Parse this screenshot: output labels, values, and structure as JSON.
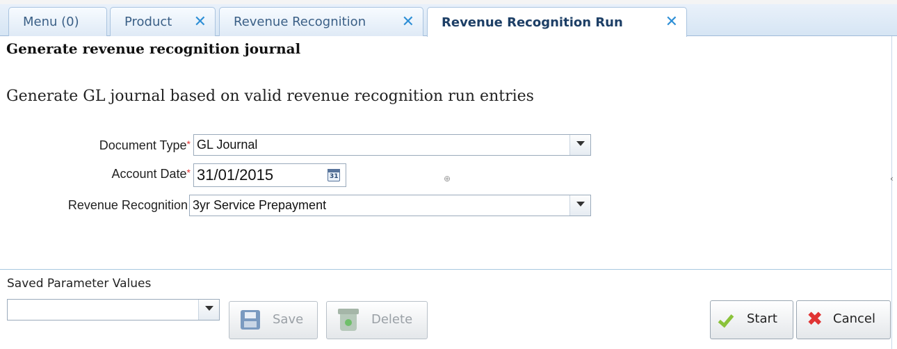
{
  "tabs": [
    {
      "label": "Menu (0)",
      "closable": false,
      "active": false
    },
    {
      "label": "Product",
      "closable": true,
      "active": false
    },
    {
      "label": "Revenue Recognition",
      "closable": true,
      "active": false
    },
    {
      "label": "Revenue Recognition Run",
      "closable": true,
      "active": true
    }
  ],
  "tab_close_glyph": "✕",
  "page_title": "Generate revenue recognition journal",
  "description": "Generate GL journal based on valid revenue recognition run entries",
  "form": {
    "required_mark": "*",
    "document_type": {
      "label": "Document Type",
      "value": "GL Journal",
      "required": true
    },
    "account_date": {
      "label": "Account Date",
      "value": "31/01/2015",
      "required": true,
      "calendar_day": "31"
    },
    "revenue_recognition": {
      "label": "Revenue Recognition",
      "value": "3yr Service Prepayment",
      "required": false
    }
  },
  "saved_params": {
    "label": "Saved Parameter Values",
    "value": ""
  },
  "buttons": {
    "save": "Save",
    "delete": "Delete",
    "start": "Start",
    "cancel": "Cancel"
  },
  "misc": {
    "crosshair": "⊕",
    "edge_mark": "‹"
  },
  "colors": {
    "tab_close": "#2e8fd6",
    "required": "#e03030",
    "start_check": "#8ac23a",
    "cancel_x": "#e03434"
  },
  "icons": [
    "close-icon",
    "chevron-down-icon",
    "calendar-icon",
    "save-icon",
    "delete-icon",
    "check-icon",
    "cancel-icon"
  ]
}
